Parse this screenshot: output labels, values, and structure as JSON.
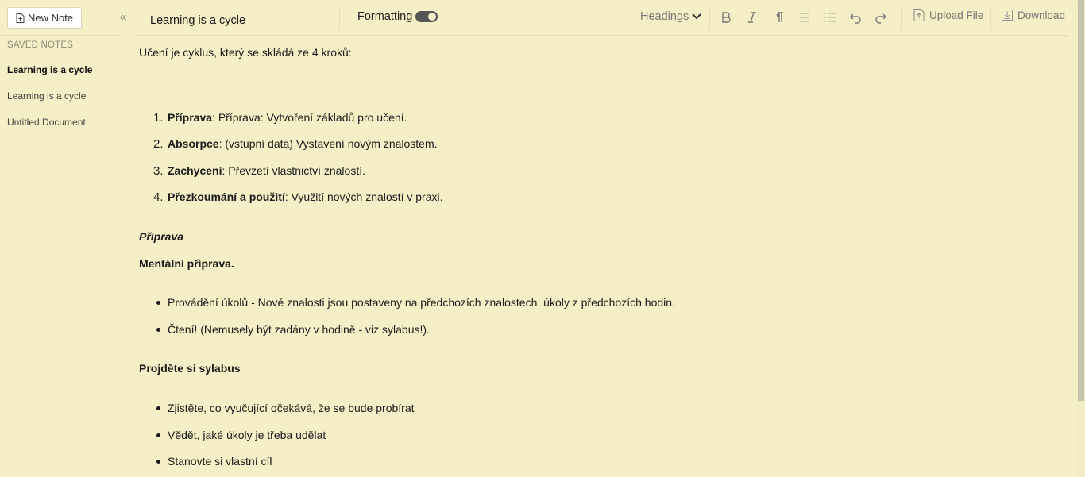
{
  "sidebar": {
    "new_note_label": "New Note",
    "collapse_label": "«",
    "saved_notes_title": "SAVED NOTES",
    "notes": [
      {
        "title": "Learning is a cycle",
        "active": true
      },
      {
        "title": "Learning is a cycle",
        "active": false
      },
      {
        "title": "Untitled Document",
        "active": false
      }
    ]
  },
  "toolbar": {
    "document_title": "Learning is a cycle",
    "formatting_label": "Formatting",
    "formatting_enabled": true,
    "headings_label": "Headings",
    "upload_label": "Upload File",
    "download_label": "Download"
  },
  "document": {
    "intro": "Učení je cyklus, který se skládá ze 4 kroků:",
    "steps": [
      {
        "num": "1.",
        "term": "Příprava",
        "rest": ": Příprava: Vytvoření základů pro učení."
      },
      {
        "num": "2.",
        "term": "Absorpce",
        "rest": ": (vstupní data) Vystavení novým znalostem."
      },
      {
        "num": "3.",
        "term": "Zachycení",
        "rest": ": Převzetí vlastnictví znalostí."
      },
      {
        "num": "4.",
        "term": "Přezkoumání a použití",
        "rest": ": Využití nových znalostí v praxi."
      }
    ],
    "section_heading": "Příprava",
    "subheading_1": "Mentální příprava.",
    "bullets_1": [
      "Provádění úkolů - Nové znalosti jsou postaveny na předchozích znalostech. úkoly z předchozích hodin.",
      "Čtení! (Nemusely být zadány v hodině - viz sylabus!)."
    ],
    "subheading_2": "Projděte si sylabus",
    "bullets_2": [
      "Zjistěte, co vyučující očekává, že se bude probírat",
      "Vědět, jaké úkoly je třeba udělat",
      "Stanovte si vlastní cíl"
    ]
  }
}
